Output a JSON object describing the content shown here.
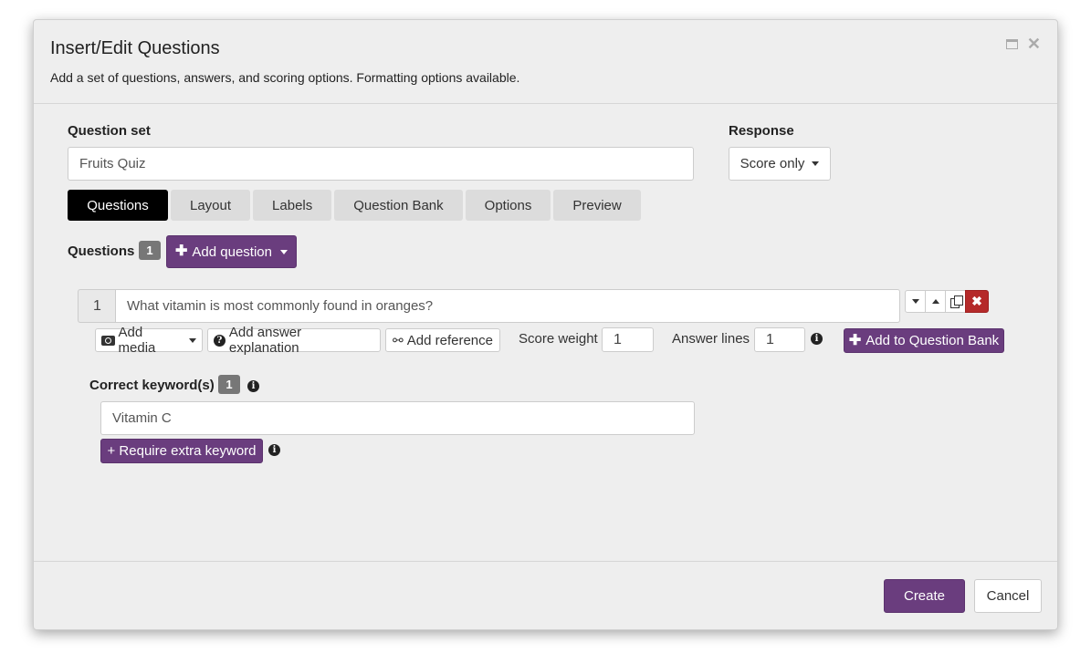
{
  "dialog": {
    "title": "Insert/Edit Questions",
    "subtitle": "Add a set of questions, answers, and scoring options. Formatting options available."
  },
  "question_set": {
    "label": "Question set",
    "value": "Fruits Quiz"
  },
  "response": {
    "label": "Response",
    "value": "Score only"
  },
  "tabs": [
    {
      "label": "Questions",
      "active": true
    },
    {
      "label": "Layout"
    },
    {
      "label": "Labels"
    },
    {
      "label": "Question Bank"
    },
    {
      "label": "Options"
    },
    {
      "label": "Preview"
    }
  ],
  "questions": {
    "label": "Questions",
    "count": "1",
    "add_label": "Add question"
  },
  "question_item": {
    "number": "1",
    "text": "What vitamin is most commonly found in oranges?",
    "add_media_label": "Add media",
    "add_explanation_label": "Add answer explanation",
    "add_reference_label": "Add reference",
    "score_weight_label": "Score weight",
    "score_weight_value": "1",
    "answer_lines_label": "Answer lines",
    "answer_lines_value": "1",
    "add_to_bank_label": "Add to Question Bank"
  },
  "keywords": {
    "label": "Correct keyword(s)",
    "count": "1",
    "value": "Vitamin C",
    "require_extra_label": "+ Require extra keyword"
  },
  "footer": {
    "create_label": "Create",
    "cancel_label": "Cancel"
  },
  "colors": {
    "purple": "#6a3d7e",
    "delete_red": "#b52a2a",
    "active_tab": "#000000"
  }
}
